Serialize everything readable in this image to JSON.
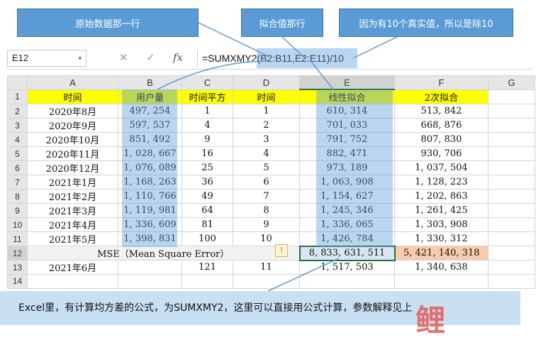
{
  "callouts": {
    "original_row": "原始数据那一行",
    "fitted_row": "拟合值那行",
    "divide": "因为有10个真实值，所以是除10"
  },
  "toolbar": {
    "name_box": "E12",
    "name_dropdown": "▾",
    "cancel_icon": "✕",
    "enter_icon": "✓",
    "fx_icon": "fx",
    "formula": "=SUMXMY2(B2:B11,E2:E11)/10"
  },
  "columns": [
    "A",
    "B",
    "C",
    "D",
    "E",
    "F",
    "G"
  ],
  "header_row": [
    "时间",
    "用户量",
    "时间平方",
    "时间",
    "线性拟合",
    "2次拟合"
  ],
  "rows": [
    {
      "n": "2",
      "A": "2020年8月",
      "B": "497, 254",
      "C": "1",
      "D": "1",
      "E": "610, 314",
      "F": "513, 842"
    },
    {
      "n": "3",
      "A": "2020年9月",
      "B": "597, 537",
      "C": "4",
      "D": "2",
      "E": "701, 033",
      "F": "668, 876"
    },
    {
      "n": "4",
      "A": "2020年10月",
      "B": "851, 492",
      "C": "9",
      "D": "3",
      "E": "791, 752",
      "F": "807, 830"
    },
    {
      "n": "5",
      "A": "2020年11月",
      "B": "1, 028, 667",
      "C": "16",
      "D": "4",
      "E": "882, 471",
      "F": "930, 706"
    },
    {
      "n": "6",
      "A": "2020年12月",
      "B": "1, 076, 089",
      "C": "25",
      "D": "5",
      "E": "973, 189",
      "F": "1, 037, 504"
    },
    {
      "n": "7",
      "A": "2021年1月",
      "B": "1, 168, 263",
      "C": "36",
      "D": "6",
      "E": "1, 063, 908",
      "F": "1, 128, 223"
    },
    {
      "n": "8",
      "A": "2021年2月",
      "B": "1, 110, 766",
      "C": "49",
      "D": "7",
      "E": "1, 154, 627",
      "F": "1, 202, 863"
    },
    {
      "n": "9",
      "A": "2021年3月",
      "B": "1, 119, 981",
      "C": "64",
      "D": "8",
      "E": "1, 245, 346",
      "F": "1, 261, 425"
    },
    {
      "n": "10",
      "A": "2021年4月",
      "B": "1, 336, 609",
      "C": "81",
      "D": "9",
      "E": "1, 336, 065",
      "F": "1, 303, 908"
    },
    {
      "n": "11",
      "A": "2021年5月",
      "B": "1, 398, 831",
      "C": "100",
      "D": "10",
      "E": "1, 426, 784",
      "F": "1, 330, 312"
    }
  ],
  "mse_row": {
    "n": "12",
    "label": "MSE（Mean Square Error）",
    "warn": "!",
    "E": "8, 833, 631, 511",
    "F": "5, 421, 140, 318"
  },
  "row13": {
    "n": "13",
    "A": "2021年6月",
    "C": "121",
    "D": "11",
    "E": "1, 517, 503",
    "F": "1, 340, 638"
  },
  "row14": {
    "n": "14"
  },
  "row1_num": "1",
  "bottom_text": "Excel里，有计算均方差的公式，为SUMXMY2，这里可以直接用公式计算，参数解释见上",
  "logo_text": "鲤",
  "colors": {
    "accent": "#5b9bd5",
    "yellow": "#ffff00",
    "selection": "#217346"
  }
}
